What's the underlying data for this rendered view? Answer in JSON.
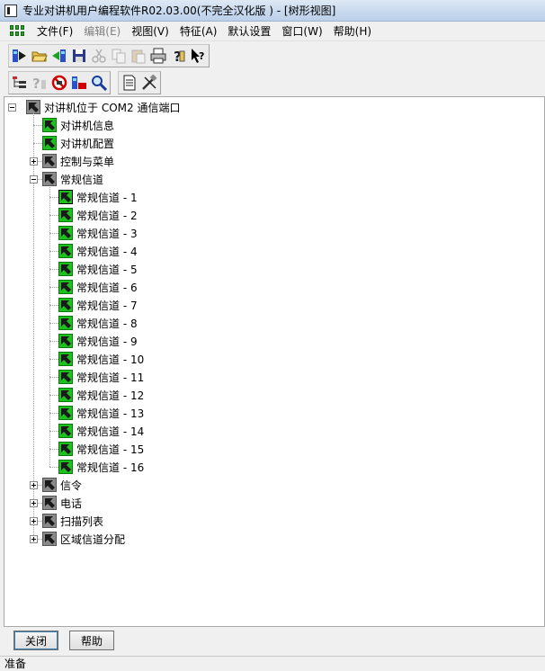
{
  "window": {
    "title": "专业对讲机用户编程软件R02.03.00(不完全汉化版 ) - [树形视图]"
  },
  "menu": [
    {
      "label": "文件(F)",
      "enabled": true
    },
    {
      "label": "编辑(E)",
      "enabled": false
    },
    {
      "label": "视图(V)",
      "enabled": true
    },
    {
      "label": "特征(A)",
      "enabled": true
    },
    {
      "label": "默认设置",
      "enabled": true
    },
    {
      "label": "窗口(W)",
      "enabled": true
    },
    {
      "label": "帮助(H)",
      "enabled": true
    }
  ],
  "toolbar1": [
    {
      "name": "read-radio-icon",
      "enabled": true
    },
    {
      "name": "open-folder-icon",
      "enabled": true
    },
    {
      "name": "write-radio-icon",
      "enabled": true
    },
    {
      "name": "save-icon",
      "enabled": true
    },
    {
      "name": "cut-icon",
      "enabled": false
    },
    {
      "name": "copy-icon",
      "enabled": false
    },
    {
      "name": "paste-icon",
      "enabled": false
    },
    {
      "name": "print-icon",
      "enabled": true
    },
    {
      "name": "help-icon",
      "enabled": true
    },
    {
      "name": "context-help-icon",
      "enabled": true
    }
  ],
  "toolbar2": [
    {
      "name": "tree-view-icon",
      "enabled": true
    },
    {
      "name": "unknown-help-icon",
      "enabled": false
    },
    {
      "name": "no-entry-icon",
      "enabled": true
    },
    {
      "name": "radio-config-icon",
      "enabled": true
    },
    {
      "name": "search-icon",
      "enabled": true
    },
    {
      "name": "document-icon",
      "enabled": true
    },
    {
      "name": "tools-icon",
      "enabled": true
    }
  ],
  "tree": {
    "root": {
      "label": "对讲机位于 COM2 通信端口"
    },
    "items": [
      {
        "label": "对讲机信息",
        "level": 1,
        "expander": "none",
        "active": true
      },
      {
        "label": "对讲机配置",
        "level": 1,
        "expander": "none",
        "active": true
      },
      {
        "label": "控制与菜单",
        "level": 1,
        "expander": "plus",
        "active": false
      },
      {
        "label": "常规信道",
        "level": 1,
        "expander": "minus",
        "active": false
      },
      {
        "label": "常规信道 - 1",
        "level": 2,
        "expander": "none",
        "active": true,
        "selected": true
      },
      {
        "label": "常规信道 - 2",
        "level": 2,
        "expander": "none",
        "active": true
      },
      {
        "label": "常规信道 - 3",
        "level": 2,
        "expander": "none",
        "active": true
      },
      {
        "label": "常规信道 - 4",
        "level": 2,
        "expander": "none",
        "active": true
      },
      {
        "label": "常规信道 - 5",
        "level": 2,
        "expander": "none",
        "active": true
      },
      {
        "label": "常规信道 - 6",
        "level": 2,
        "expander": "none",
        "active": true
      },
      {
        "label": "常规信道 - 7",
        "level": 2,
        "expander": "none",
        "active": true
      },
      {
        "label": "常规信道 - 8",
        "level": 2,
        "expander": "none",
        "active": true
      },
      {
        "label": "常规信道 - 9",
        "level": 2,
        "expander": "none",
        "active": true
      },
      {
        "label": "常规信道 - 10",
        "level": 2,
        "expander": "none",
        "active": true
      },
      {
        "label": "常规信道 - 11",
        "level": 2,
        "expander": "none",
        "active": true
      },
      {
        "label": "常规信道 - 12",
        "level": 2,
        "expander": "none",
        "active": true
      },
      {
        "label": "常规信道 - 13",
        "level": 2,
        "expander": "none",
        "active": true
      },
      {
        "label": "常规信道 - 14",
        "level": 2,
        "expander": "none",
        "active": true
      },
      {
        "label": "常规信道 - 15",
        "level": 2,
        "expander": "none",
        "active": true
      },
      {
        "label": "常规信道 - 16",
        "level": 2,
        "expander": "none",
        "active": true
      },
      {
        "label": "信令",
        "level": 1,
        "expander": "plus",
        "active": false
      },
      {
        "label": "电话",
        "level": 1,
        "expander": "plus",
        "active": false
      },
      {
        "label": "扫描列表",
        "level": 1,
        "expander": "plus",
        "active": false
      },
      {
        "label": "区域信道分配",
        "level": 1,
        "expander": "plus",
        "active": false
      }
    ]
  },
  "buttons": {
    "close": "关闭",
    "help": "帮助"
  },
  "status": {
    "text": "准备"
  },
  "colors": {
    "active_icon": "#1fbf1f",
    "folder_icon": "#8a8a8a",
    "title_bar": "#c8d9ee"
  }
}
